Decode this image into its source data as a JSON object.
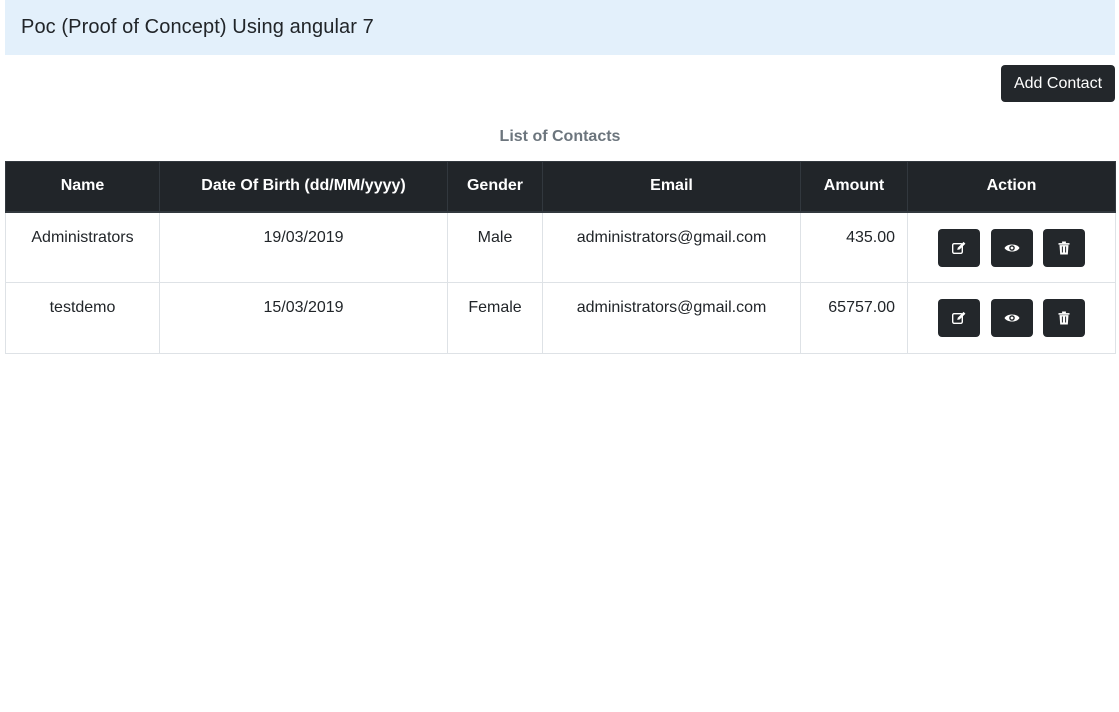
{
  "navbar": {
    "title": "Poc (Proof of Concept) Using angular 7"
  },
  "toolbar": {
    "add_label": "Add Contact"
  },
  "list": {
    "title": "List of Contacts",
    "columns": [
      "Name",
      "Date Of Birth (dd/MM/yyyy)",
      "Gender",
      "Email",
      "Amount",
      "Action"
    ],
    "rows": [
      {
        "name": "Administrators",
        "dob": "19/03/2019",
        "gender": "Male",
        "email": "administrators@gmail.com",
        "amount": "435.00"
      },
      {
        "name": "testdemo",
        "dob": "15/03/2019",
        "gender": "Female",
        "email": "administrators@gmail.com",
        "amount": "65757.00"
      }
    ],
    "action_icons": [
      "edit-icon",
      "eye-icon",
      "trash-icon"
    ]
  },
  "colors": {
    "navbar_bg": "#e3f0fb",
    "dark": "#212529",
    "muted": "#6c757d"
  }
}
